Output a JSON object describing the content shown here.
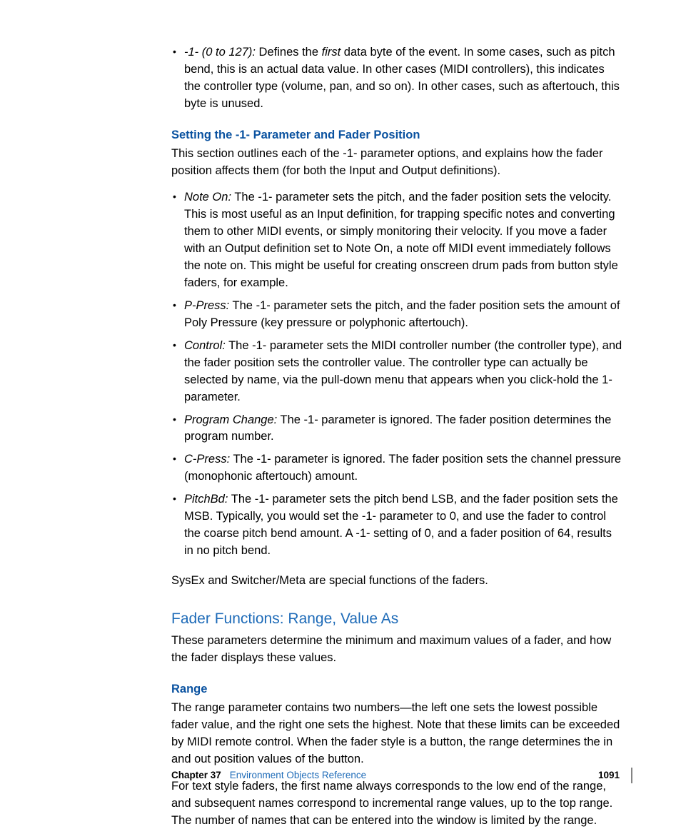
{
  "bullet1": {
    "term": "-1- (0 to 127):",
    "text_a": "  Defines the ",
    "first": "first",
    "text_b": " data byte of the event. In some cases, such as pitch bend, this is an actual data value. In other cases (MIDI controllers), this indicates the controller type (volume, pan, and so on). In other cases, such as aftertouch, this byte is unused."
  },
  "heading1": "Setting the -1- Parameter and Fader Position",
  "intro1": "This section outlines each of the -1- parameter options, and explains how the fader position affects them (for both the Input and Output definitions).",
  "list2": [
    {
      "term": "Note On:",
      "text": "  The -1- parameter sets the pitch, and the fader position sets the velocity. This is most useful as an Input definition, for trapping specific notes and converting them to other MIDI events, or simply monitoring their velocity. If you move a fader with an Output definition set to Note On, a note off MIDI event immediately follows the note on. This might be useful for creating onscreen drum pads from button style faders, for example."
    },
    {
      "term": "P-Press:",
      "text": "  The -1- parameter sets the pitch, and the fader position sets the amount of Poly Pressure (key pressure or polyphonic aftertouch)."
    },
    {
      "term": "Control:",
      "text": "  The -1- parameter sets the MIDI controller number (the controller type), and the fader position sets the controller value. The controller type can actually be selected by name, via the pull-down menu that appears when you click-hold the 1- parameter."
    },
    {
      "term": "Program Change:",
      "text": "  The -1- parameter is ignored. The fader position determines the program number."
    },
    {
      "term": "C-Press:",
      "text": "  The -1- parameter is ignored. The fader position sets the channel pressure (monophonic aftertouch) amount."
    },
    {
      "term": "PitchBd:",
      "text": "  The -1- parameter sets the pitch bend LSB, and the fader position sets the MSB. Typically, you would set the -1- parameter to 0, and use the fader to control the coarse pitch bend amount. A -1- setting of 0, and a fader position of 64, results in no pitch bend."
    }
  ],
  "para_sysex": "SysEx and Switcher/Meta are special functions of the faders.",
  "heading2": "Fader Functions:  Range, Value As",
  "para_h2": "These parameters determine the minimum and maximum values of a fader, and how the fader displays these values.",
  "heading3": "Range",
  "para_range1": "The range parameter contains two numbers—the left one sets the lowest possible fader value, and the right one sets the highest. Note that these limits can be exceeded by MIDI remote control. When the fader style is a button, the range determines the in and out position values of the button.",
  "para_range2": "For text style faders, the first name always corresponds to the low end of the range, and subsequent names correspond to incremental range values, up to the top range. The number of names that can be entered into the window is limited by the range.",
  "footer": {
    "chapter_label": "Chapter 37",
    "chapter_title": "Environment Objects Reference",
    "page": "1091"
  }
}
